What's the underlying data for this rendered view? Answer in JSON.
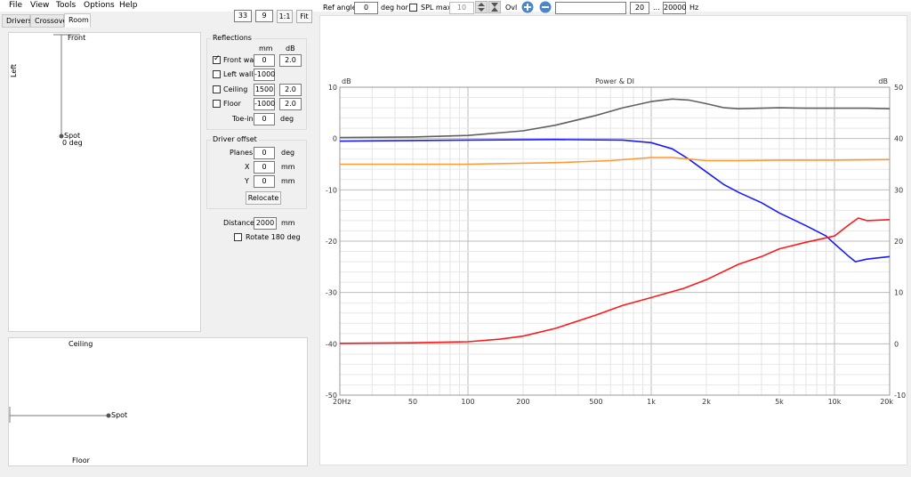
{
  "menu": [
    "File",
    "View",
    "Tools",
    "Options",
    "Help"
  ],
  "tabs": [
    "Drivers",
    "Crossover",
    "Room"
  ],
  "view_controls": {
    "zoom_a": "33",
    "zoom_b": "9",
    "one_to_one": "1:1",
    "fit": "Fit"
  },
  "room_top": {
    "front": "Front",
    "left": "Left",
    "spot": "Spot",
    "spot_deg": "0 deg"
  },
  "room_side": {
    "ceiling": "Ceiling",
    "floor": "Floor",
    "spot": "Spot"
  },
  "reflections": {
    "title": "Reflections",
    "col_mm": "mm",
    "col_db": "dB",
    "rows": [
      {
        "label": "Front wall",
        "checked": true,
        "mm": "0",
        "db": "2.0"
      },
      {
        "label": "Left wall",
        "checked": false,
        "mm": "-1000",
        "db": ""
      },
      {
        "label": "Ceiling",
        "checked": false,
        "mm": "1500",
        "db": "2.0"
      },
      {
        "label": "Floor",
        "checked": false,
        "mm": "-1000",
        "db": "2.0"
      }
    ],
    "toein_label": "Toe-in",
    "toein_value": "0",
    "toein_unit": "deg"
  },
  "driver_offset": {
    "title": "Driver offset",
    "planes_label": "Planes",
    "planes_value": "0",
    "planes_unit": "deg",
    "x_label": "X",
    "x_value": "0",
    "x_unit": "mm",
    "y_label": "Y",
    "y_value": "0",
    "y_unit": "mm",
    "relocate": "Relocate"
  },
  "distance": {
    "label": "Distance",
    "value": "2000",
    "unit": "mm"
  },
  "rotate": {
    "label": "Rotate 180 deg",
    "checked": false
  },
  "graph_toolbar": {
    "ref_angle_label": "Ref angle",
    "ref_angle_value": "0",
    "deg_hor": "deg hor",
    "spl_max_label": "SPL max",
    "spl_max_value": "10",
    "ovl_label": "Ovl",
    "freq_min": "20",
    "freq_sep": "...",
    "freq_max": "20000",
    "hz": "Hz"
  },
  "chart_data": {
    "type": "line",
    "title": "Power & DI",
    "ylabel_left": "dB",
    "ylabel_right": "dB",
    "x_scale": "log",
    "xlim": [
      20,
      20000
    ],
    "ylim_left": [
      -50,
      10
    ],
    "ylim_right": [
      -10,
      50
    ],
    "x_tick_labels": [
      {
        "v": 20,
        "t": "20Hz"
      },
      {
        "v": 50,
        "t": "50"
      },
      {
        "v": 100,
        "t": "100"
      },
      {
        "v": 200,
        "t": "200"
      },
      {
        "v": 500,
        "t": "500"
      },
      {
        "v": 1000,
        "t": "1k"
      },
      {
        "v": 2000,
        "t": "2k"
      },
      {
        "v": 5000,
        "t": "5k"
      },
      {
        "v": 10000,
        "t": "10k"
      },
      {
        "v": 20000,
        "t": "20k"
      }
    ],
    "y_left_ticks": [
      10,
      0,
      -10,
      -20,
      -30,
      -40,
      -50
    ],
    "y_right_ticks": [
      50,
      40,
      30,
      20,
      10,
      0,
      -10
    ],
    "grid": true,
    "series": [
      {
        "color": "#606060",
        "axis": "left",
        "points": [
          [
            20,
            0.2
          ],
          [
            50,
            0.3
          ],
          [
            100,
            0.6
          ],
          [
            200,
            1.5
          ],
          [
            300,
            2.6
          ],
          [
            500,
            4.5
          ],
          [
            700,
            6
          ],
          [
            1000,
            7.2
          ],
          [
            1300,
            7.7
          ],
          [
            1600,
            7.5
          ],
          [
            2000,
            6.8
          ],
          [
            2500,
            6
          ],
          [
            3000,
            5.8
          ],
          [
            4000,
            5.9
          ],
          [
            5000,
            6
          ],
          [
            7000,
            5.9
          ],
          [
            10000,
            5.9
          ],
          [
            15000,
            5.9
          ],
          [
            20000,
            5.8
          ]
        ]
      },
      {
        "color": "#1a1aff",
        "axis": "left",
        "points": [
          [
            20,
            -0.5
          ],
          [
            100,
            -0.3
          ],
          [
            300,
            -0.2
          ],
          [
            700,
            -0.3
          ],
          [
            1000,
            -0.8
          ],
          [
            1300,
            -2
          ],
          [
            1600,
            -4
          ],
          [
            2000,
            -6.5
          ],
          [
            2500,
            -9
          ],
          [
            3000,
            -10.5
          ],
          [
            4000,
            -12.5
          ],
          [
            5000,
            -14.5
          ],
          [
            7000,
            -17
          ],
          [
            9000,
            -19
          ],
          [
            10000,
            -20.5
          ],
          [
            12000,
            -23
          ],
          [
            13000,
            -24
          ],
          [
            15000,
            -23.5
          ],
          [
            20000,
            -23
          ]
        ]
      },
      {
        "color": "#ff9933",
        "axis": "left",
        "points": [
          [
            20,
            -5
          ],
          [
            100,
            -5
          ],
          [
            300,
            -4.7
          ],
          [
            600,
            -4.3
          ],
          [
            1000,
            -3.7
          ],
          [
            1300,
            -3.7
          ],
          [
            2000,
            -4.3
          ],
          [
            3000,
            -4.3
          ],
          [
            5000,
            -4.2
          ],
          [
            10000,
            -4.2
          ],
          [
            20000,
            -4.1
          ]
        ]
      },
      {
        "color": "#ff1a1a",
        "axis": "right",
        "points": [
          [
            20,
            0.1
          ],
          [
            50,
            0.2
          ],
          [
            100,
            0.4
          ],
          [
            150,
            0.9
          ],
          [
            200,
            1.5
          ],
          [
            300,
            3
          ],
          [
            500,
            5.6
          ],
          [
            700,
            7.5
          ],
          [
            1000,
            9
          ],
          [
            1500,
            10.8
          ],
          [
            2000,
            12.5
          ],
          [
            3000,
            15.5
          ],
          [
            4000,
            17
          ],
          [
            5000,
            18.5
          ],
          [
            7000,
            19.8
          ],
          [
            10000,
            21
          ],
          [
            12000,
            23.2
          ],
          [
            13500,
            24.5
          ],
          [
            15000,
            24
          ],
          [
            20000,
            24.2
          ]
        ]
      }
    ]
  }
}
